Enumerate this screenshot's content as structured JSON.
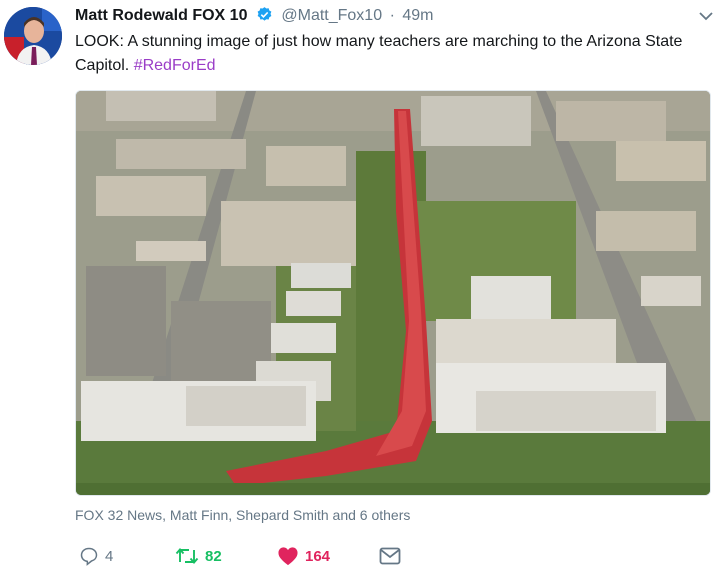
{
  "tweet": {
    "display_name": "Matt Rodewald FOX 10",
    "handle": "@Matt_Fox10",
    "separator": "·",
    "time": "49m",
    "text_before": "LOOK: A stunning image of just how many teachers are marching to the Arizona State Capitol. ",
    "hashtag": "#RedForEd",
    "context": "FOX 32 News, Matt Finn, Shepard Smith and 6 others",
    "reply_count": "4",
    "retweet_count": "82",
    "like_count": "164"
  },
  "colors": {
    "verified": "#1da1f2",
    "hashtag": "#9a3dc7",
    "retweet": "#17bf63",
    "like": "#e0245e",
    "muted": "#657786"
  },
  "icons": [
    "verified-icon",
    "chevron-down-icon",
    "reply-icon",
    "retweet-icon",
    "heart-icon",
    "mail-icon"
  ]
}
